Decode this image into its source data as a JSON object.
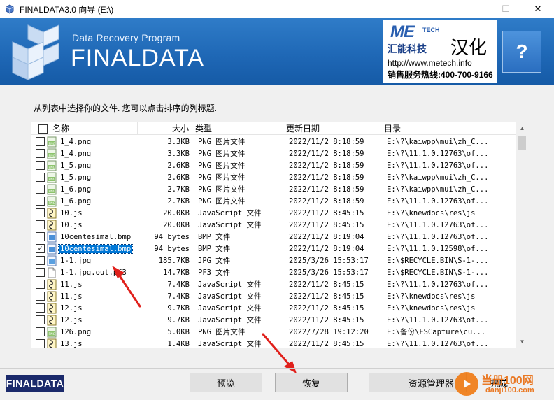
{
  "window": {
    "title": "FINALDATA3.0 向导 (E:\\)",
    "minimize": "—",
    "maximize": "☐",
    "close": "✕"
  },
  "banner": {
    "subtitle": "Data Recovery Program",
    "title": "FINALDATA",
    "partner_logo": "ME",
    "partner_tech": "TECH",
    "partner_cn": "汇能科技",
    "partner_hanhua": "汉化",
    "partner_url": "http://www.metech.info",
    "partner_phone": "销售服务热线:400-700-9166",
    "help_label": "?"
  },
  "instruction": "从列表中选择你的文件. 您可以点击排序的列标题.",
  "columns": {
    "name": "名称",
    "size": "大小",
    "type": "类型",
    "date": "更新日期",
    "dir": "目录"
  },
  "rows": [
    {
      "name": "1_4.png",
      "size": "3.3KB",
      "type": "PNG 图片文件",
      "date": "2022/11/2  8:18:59",
      "dir": "E:\\?\\kaiwpp\\mui\\zh_C...",
      "icon": "png-file-icon",
      "checked": false,
      "selected": false
    },
    {
      "name": "1_4.png",
      "size": "3.3KB",
      "type": "PNG 图片文件",
      "date": "2022/11/2  8:18:59",
      "dir": "E:\\?\\11.1.0.12763\\of...",
      "icon": "png-file-icon",
      "checked": false,
      "selected": false
    },
    {
      "name": "1_5.png",
      "size": "2.6KB",
      "type": "PNG 图片文件",
      "date": "2022/11/2  8:18:59",
      "dir": "E:\\?\\11.1.0.12763\\of...",
      "icon": "png-file-icon",
      "checked": false,
      "selected": false
    },
    {
      "name": "1_5.png",
      "size": "2.6KB",
      "type": "PNG 图片文件",
      "date": "2022/11/2  8:18:59",
      "dir": "E:\\?\\kaiwpp\\mui\\zh_C...",
      "icon": "png-file-icon",
      "checked": false,
      "selected": false
    },
    {
      "name": "1_6.png",
      "size": "2.7KB",
      "type": "PNG 图片文件",
      "date": "2022/11/2  8:18:59",
      "dir": "E:\\?\\kaiwpp\\mui\\zh_C...",
      "icon": "png-file-icon",
      "checked": false,
      "selected": false
    },
    {
      "name": "1_6.png",
      "size": "2.7KB",
      "type": "PNG 图片文件",
      "date": "2022/11/2  8:18:59",
      "dir": "E:\\?\\11.1.0.12763\\of...",
      "icon": "png-file-icon",
      "checked": false,
      "selected": false
    },
    {
      "name": "10.js",
      "size": "20.0KB",
      "type": "JavaScript 文件",
      "date": "2022/11/2  8:45:15",
      "dir": "E:\\?\\knewdocs\\res\\js",
      "icon": "js-file-icon",
      "checked": false,
      "selected": false
    },
    {
      "name": "10.js",
      "size": "20.0KB",
      "type": "JavaScript 文件",
      "date": "2022/11/2  8:45:15",
      "dir": "E:\\?\\11.1.0.12763\\of...",
      "icon": "js-file-icon",
      "checked": false,
      "selected": false
    },
    {
      "name": "10centesimal.bmp",
      "size": "94 bytes",
      "type": "BMP 文件",
      "date": "2022/11/2  8:19:04",
      "dir": "E:\\?\\11.1.0.12763\\of...",
      "icon": "bmp-file-icon",
      "checked": false,
      "selected": false
    },
    {
      "name": "10centesimal.bmp",
      "size": "94 bytes",
      "type": "BMP 文件",
      "date": "2022/11/2  8:19:04",
      "dir": "E:\\?\\11.1.0.12598\\of...",
      "icon": "bmp-file-icon",
      "checked": true,
      "selected": true
    },
    {
      "name": "1-1.jpg",
      "size": "185.7KB",
      "type": "JPG 文件",
      "date": "2025/3/26 15:53:17",
      "dir": "E:\\$RECYCLE.BIN\\S-1-...",
      "icon": "jpg-file-icon",
      "checked": false,
      "selected": false
    },
    {
      "name": "1-1.jpg.out.pf3",
      "size": "14.7KB",
      "type": "PF3 文件",
      "date": "2025/3/26 15:53:17",
      "dir": "E:\\$RECYCLE.BIN\\S-1-...",
      "icon": "blank-file-icon",
      "checked": false,
      "selected": false
    },
    {
      "name": "11.js",
      "size": "7.4KB",
      "type": "JavaScript 文件",
      "date": "2022/11/2  8:45:15",
      "dir": "E:\\?\\11.1.0.12763\\of...",
      "icon": "js-file-icon",
      "checked": false,
      "selected": false
    },
    {
      "name": "11.js",
      "size": "7.4KB",
      "type": "JavaScript 文件",
      "date": "2022/11/2  8:45:15",
      "dir": "E:\\?\\knewdocs\\res\\js",
      "icon": "js-file-icon",
      "checked": false,
      "selected": false
    },
    {
      "name": "12.js",
      "size": "9.7KB",
      "type": "JavaScript 文件",
      "date": "2022/11/2  8:45:15",
      "dir": "E:\\?\\knewdocs\\res\\js",
      "icon": "js-file-icon",
      "checked": false,
      "selected": false
    },
    {
      "name": "12.js",
      "size": "9.7KB",
      "type": "JavaScript 文件",
      "date": "2022/11/2  8:45:15",
      "dir": "E:\\?\\11.1.0.12763\\of...",
      "icon": "js-file-icon",
      "checked": false,
      "selected": false
    },
    {
      "name": "126.png",
      "size": "5.0KB",
      "type": "PNG 图片文件",
      "date": "2022/7/28 19:12:20",
      "dir": "E:\\备份\\FSCapture\\cu...",
      "icon": "png-file-icon",
      "checked": false,
      "selected": false
    },
    {
      "name": "13.js",
      "size": "1.4KB",
      "type": "JavaScript 文件",
      "date": "2022/11/2  8:45:15",
      "dir": "E:\\?\\11.1.0.12763\\of...",
      "icon": "js-file-icon",
      "checked": false,
      "selected": false
    }
  ],
  "buttons": {
    "logo": "FINALDATA",
    "preview": "预览",
    "recover": "恢复",
    "explorer": "资源管理器",
    "finish": "完成"
  },
  "watermark": {
    "text": "当册100网",
    "url": "danji100.com"
  },
  "colors": {
    "banner": "#1f68b6",
    "selection": "#0078d7",
    "annotation_arrow": "#e0201b"
  }
}
